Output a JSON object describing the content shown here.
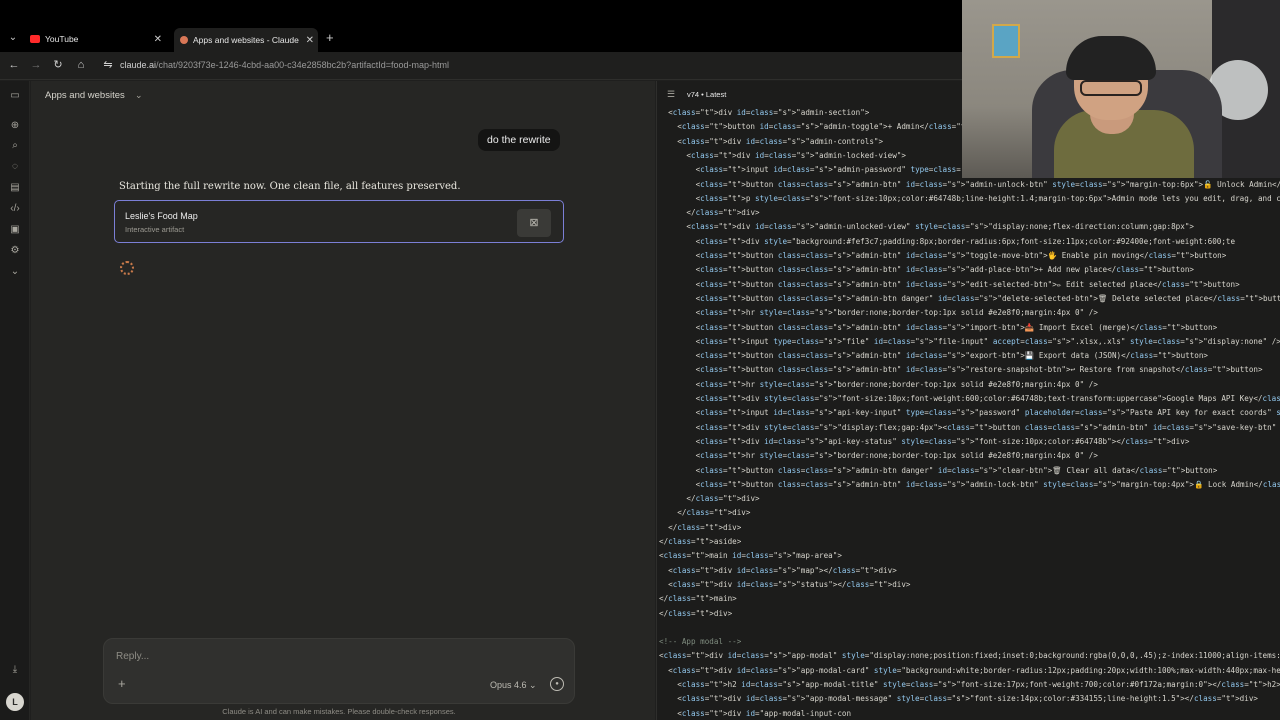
{
  "browser": {
    "tabs": [
      {
        "label": "YouTube",
        "active": false,
        "favicon_color": "#ff2a2a"
      },
      {
        "label": "Apps and websites - Claude",
        "active": true,
        "favicon_color": "#d97757"
      }
    ],
    "url_main": "claude.ai",
    "url_rest": "/chat/9203f73e-1246-4cbd-aa00-c34e2858bc2b?artifactId=food-map-html"
  },
  "chat": {
    "title": "Apps and websites",
    "user_message": "do the rewrite",
    "assistant_message": "Starting the full rewrite now. One clean file, all features preserved.",
    "artifact": {
      "title": "Leslie's Food Map",
      "subtitle": "Interactive artifact"
    },
    "composer": {
      "placeholder": "Reply...",
      "model": "Opus 4.6"
    },
    "disclaimer": "Claude is AI and can make mistakes. Please double-check responses."
  },
  "user": {
    "avatar_initial": "L"
  },
  "code_panel": {
    "version_label": "v74 • Latest",
    "lines": [
      "  <div id=\"admin-section\">",
      "    <button id=\"admin-toggle\">+ Admin</button>",
      "    <div id=\"admin-controls\">",
      "      <div id=\"admin-locked-view\">",
      "        <input id=\"admin-password\" type=\"password\" placeholder=\"Password\" style=\"width:100%;padding:7px 10px;border:1px solid #d1d5db;border-radius:6px;font-size:12px;\" />",
      "        <button class=\"admin-btn\" id=\"admin-unlock-btn\" style=\"margin-top:6px\">🔓 Unlock Admin</button>",
      "        <p style=\"font-size:10px;color:#64748b;line-height:1.4;margin-top:6px\">Admin mode lets you edit, drag, and c",
      "      </div>",
      "      <div id=\"admin-unlocked-view\" style=\"display:none;flex-direction:column;gap:8px\">",
      "        <div style=\"background:#fef3c7;padding:8px;border-radius:6px;font-size:11px;color:#92400e;font-weight:600;te",
      "        <button class=\"admin-btn\" id=\"toggle-move-btn\">🖐 Enable pin moving</button>",
      "        <button class=\"admin-btn\" id=\"add-place-btn\">+ Add new place</button>",
      "        <button class=\"admin-btn\" id=\"edit-selected-btn\">✏ Edit selected place</button>",
      "        <button class=\"admin-btn danger\" id=\"delete-selected-btn\">🗑 Delete selected place</button>",
      "        <hr style=\"border:none;border-top:1px solid #e2e8f0;margin:4px 0\" />",
      "        <button class=\"admin-btn\" id=\"import-btn\">📥 Import Excel (merge)</button>",
      "        <input type=\"file\" id=\"file-input\" accept=\".xlsx,.xls\" style=\"display:none\" />",
      "        <button class=\"admin-btn\" id=\"export-btn\">💾 Export data (JSON)</button>",
      "        <button class=\"admin-btn\" id=\"restore-snapshot-btn\">↩ Restore from snapshot</button>",
      "        <hr style=\"border:none;border-top:1px solid #e2e8f0;margin:4px 0\" />",
      "        <div style=\"font-size:10px;font-weight:600;color:#64748b;text-transform:uppercase\">Google Maps API Key</div>",
      "        <input id=\"api-key-input\" type=\"password\" placeholder=\"Paste API key for exact coords\" style=\"width:100%;pad",
      "        <div style=\"display:flex;gap:4px\"><button class=\"admin-btn\" id=\"save-key-btn\" style=\"flex:1;padding:4px 8px;",
      "        <div id=\"api-key-status\" style=\"font-size:10px;color:#64748b\"></div>",
      "        <hr style=\"border:none;border-top:1px solid #e2e8f0;margin:4px 0\" />",
      "        <button class=\"admin-btn danger\" id=\"clear-btn\">🗑 Clear all data</button>",
      "        <button class=\"admin-btn\" id=\"admin-lock-btn\" style=\"margin-top:4px\">🔒 Lock Admin</button>",
      "      </div>",
      "    </div>",
      "  </div>",
      "</aside>",
      "<main id=\"map-area\">",
      "  <div id=\"map\"></div>",
      "  <div id=\"status\"></div>",
      "</main>",
      "</div>",
      "",
      "<!-- App modal -->",
      "<div id=\"app-modal\" style=\"display:none;position:fixed;inset:0;background:rgba(0,0,0,.45);z-index:11000;align-items:ce",
      "  <div id=\"app-modal-card\" style=\"background:white;border-radius:12px;padding:20px;width:100%;max-width:440px;max-hei",
      "    <h2 id=\"app-modal-title\" style=\"font-size:17px;font-weight:700;color:#0f172a;margin:0\"></h2>",
      "    <div id=\"app-modal-message\" style=\"font-size:14px;color:#334155;line-height:1.5\"></div>",
      "    <div id=\"app-modal-input-con"
    ]
  },
  "icons": {
    "tab_list": "chevron-down-icon",
    "back": "back-arrow-icon",
    "forward": "forward-arrow-icon",
    "reload": "reload-icon",
    "home": "home-icon",
    "site_info": "site-info-icon"
  }
}
